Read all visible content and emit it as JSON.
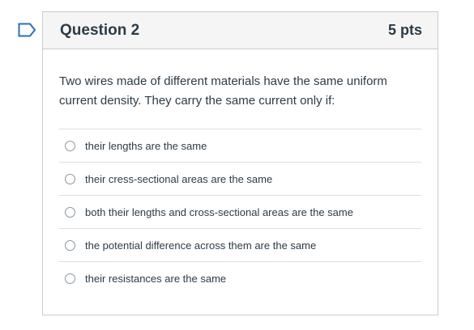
{
  "question": {
    "title": "Question 2",
    "points": "5 pts",
    "text": "Two wires made of different materials have the same uniform current density. They carry the same current only if:",
    "answers": [
      "their lengths are the same",
      "their cress-sectional areas are the same",
      "both their lengths and cross-sectional areas are the same",
      "the potential difference across them are the same",
      "their resistances are the same"
    ]
  },
  "colors": {
    "flag": "#2d6fb4",
    "header_bg": "#f5f5f5",
    "border": "#c7cdd1",
    "text": "#2d3b45"
  },
  "icons": {
    "flag": "flag-outline-icon"
  }
}
